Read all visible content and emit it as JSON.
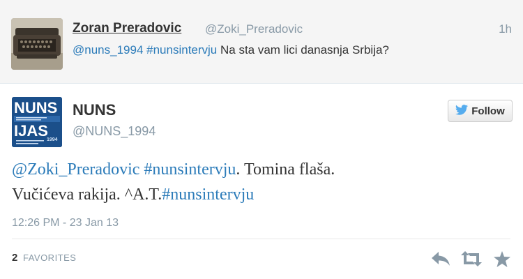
{
  "parent_tweet": {
    "name": "Zoran Preradovic",
    "handle": "@Zoki_Preradovic",
    "time": "1h",
    "mention": "@nuns_1994",
    "hashtag": "#nunsintervju",
    "text": " Na sta vam lici danasnja Srbija?",
    "avatar_icon": "typewriter-icon"
  },
  "tweet": {
    "name": "NUNS",
    "handle": "@NUNS_1994",
    "logo": {
      "line1": "NUNS",
      "line2": "IJAS",
      "badge": "1994",
      "icon": "nuns-logo"
    },
    "follow_label": "Follow",
    "text": {
      "mention": "@Zoki_Preradovic",
      "hashtag1": "#nunsintervju",
      "part1": ". Tomina flaša.",
      "part2": "Vučićeva rakija. ^A.T.",
      "hashtag2": "#nunsintervju"
    },
    "timestamp": "12:26 PM - 23 Jan 13",
    "favorites_count": "2",
    "favorites_label": "FAVORITES",
    "actions": [
      "reply-icon",
      "retweet-icon",
      "favorite-star-icon"
    ]
  },
  "colors": {
    "link": "#2b7bb9",
    "muted": "#8899a6",
    "text": "#333333",
    "parent_bg": "#f5f5f5",
    "nuns_blue": "#1b4f8a",
    "twitter_bird": "#55acee"
  }
}
